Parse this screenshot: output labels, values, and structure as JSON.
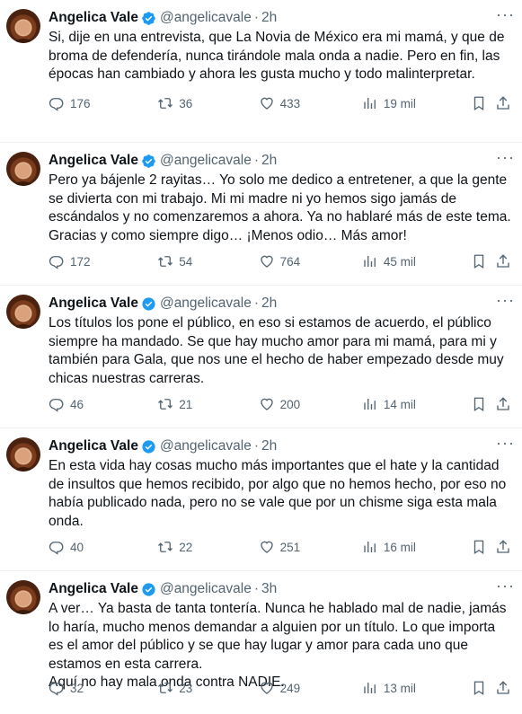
{
  "tweets": [
    {
      "name": "Angelica Vale",
      "handle": "@angelicavale",
      "time": "2h",
      "text": "Si, dije en una entrevista, que La Novia de México era mi mamá, y que de broma de defendería, nunca tirándole mala onda a nadie. Pero en fin, las épocas han cambiado y ahora les gusta mucho y todo malinterpretar.",
      "replies": "176",
      "retweets": "36",
      "likes": "433",
      "views": "19 mil"
    },
    {
      "name": "Angelica Vale",
      "handle": "@angelicavale",
      "time": "2h",
      "text": "Pero ya bájenle 2 rayitas… Yo solo me dedico a entretener, a que la gente se divierta con mi trabajo. Mi mi madre ni yo hemos sigo jamás de escándalos y no comenzaremos a ahora. Ya no hablaré más de este tema.\nGracias y como siempre digo… ¡Menos odio… Más amor!",
      "replies": "172",
      "retweets": "54",
      "likes": "764",
      "views": "45 mil"
    },
    {
      "name": "Angelica Vale",
      "handle": "@angelicavale",
      "time": "2h",
      "text": "Los títulos los pone el público, en eso si estamos de acuerdo, el público siempre ha mandado. Se que hay mucho amor para mi mamá, para mi y también para Gala, que nos une el hecho de haber empezado desde muy chicas nuestras carreras.",
      "replies": "46",
      "retweets": "21",
      "likes": "200",
      "views": "14 mil"
    },
    {
      "name": "Angelica Vale",
      "handle": "@angelicavale",
      "time": "2h",
      "text": "En esta vida hay cosas mucho más importantes que el hate y la cantidad de insultos que hemos recibido, por algo que no hemos hecho, por eso no había publicado nada, pero no se vale que por un chisme siga esta mala onda.",
      "replies": "40",
      "retweets": "22",
      "likes": "251",
      "views": "16 mil"
    },
    {
      "name": "Angelica Vale",
      "handle": "@angelicavale",
      "time": "3h",
      "text": "A ver… Ya basta de tanta tontería. Nunca he hablado mal de nadie, jamás lo haría, mucho menos demandar a alguien por un título. Lo que importa es el amor del público y se que hay lugar y amor para cada uno que estamos en esta carrera.\nAquí no hay mala onda contra NADIE.",
      "replies": "32",
      "retweets": "23",
      "likes": "249",
      "views": "13 mil"
    }
  ],
  "separator": "·",
  "more_glyph": "···",
  "colors": {
    "verified": "#1d9bf0",
    "muted": "#536471",
    "text": "#0f1419"
  },
  "icons": [
    "reply-icon",
    "retweet-icon",
    "like-icon",
    "views-icon",
    "bookmark-icon",
    "share-icon",
    "verified-icon",
    "more-icon"
  ]
}
